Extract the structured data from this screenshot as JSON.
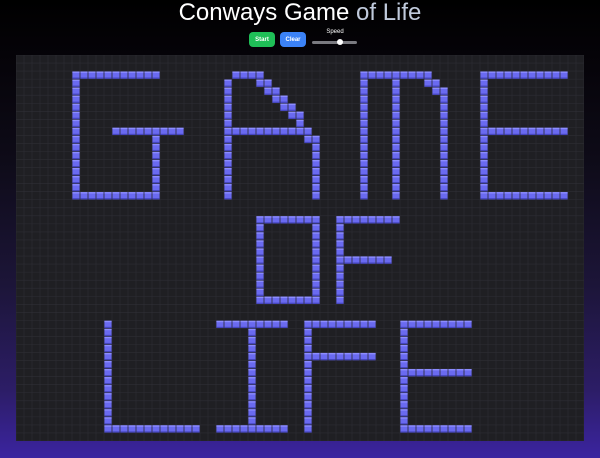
{
  "title": {
    "part1": "Conways ",
    "part2": "Game ",
    "part3": "of ",
    "part4": "Life"
  },
  "controls": {
    "start_label": "Start",
    "clear_label": "Clear",
    "speed_label": "Speed",
    "speed_value": 0.65
  },
  "colors": {
    "start_button": "#1fbf57",
    "clear_button": "#3b82f6",
    "board_background": "#1f1f23",
    "grid_line": "#2e2e35",
    "live_cell": "#6a6af0",
    "live_cell_highlight": "#8c8cff",
    "live_cell_shadow": "#4545c0"
  },
  "board": {
    "columns": 71,
    "rows": 48,
    "live_cells": [
      [
        7,
        2
      ],
      [
        8,
        2
      ],
      [
        9,
        2
      ],
      [
        10,
        2
      ],
      [
        11,
        2
      ],
      [
        12,
        2
      ],
      [
        13,
        2
      ],
      [
        14,
        2
      ],
      [
        15,
        2
      ],
      [
        16,
        2
      ],
      [
        17,
        2
      ],
      [
        7,
        3
      ],
      [
        7,
        4
      ],
      [
        7,
        5
      ],
      [
        7,
        6
      ],
      [
        7,
        7
      ],
      [
        7,
        8
      ],
      [
        7,
        9
      ],
      [
        7,
        10
      ],
      [
        7,
        11
      ],
      [
        7,
        12
      ],
      [
        7,
        13
      ],
      [
        7,
        14
      ],
      [
        7,
        15
      ],
      [
        7,
        16
      ],
      [
        7,
        17
      ],
      [
        8,
        17
      ],
      [
        9,
        17
      ],
      [
        10,
        17
      ],
      [
        11,
        17
      ],
      [
        12,
        17
      ],
      [
        13,
        17
      ],
      [
        14,
        17
      ],
      [
        15,
        17
      ],
      [
        16,
        17
      ],
      [
        17,
        17
      ],
      [
        12,
        9
      ],
      [
        13,
        9
      ],
      [
        14,
        9
      ],
      [
        15,
        9
      ],
      [
        16,
        9
      ],
      [
        17,
        9
      ],
      [
        18,
        9
      ],
      [
        19,
        9
      ],
      [
        20,
        9
      ],
      [
        17,
        10
      ],
      [
        17,
        11
      ],
      [
        17,
        12
      ],
      [
        17,
        13
      ],
      [
        17,
        14
      ],
      [
        17,
        15
      ],
      [
        17,
        16
      ],
      [
        27,
        2
      ],
      [
        28,
        2
      ],
      [
        29,
        2
      ],
      [
        30,
        2
      ],
      [
        26,
        3
      ],
      [
        30,
        3
      ],
      [
        31,
        3
      ],
      [
        26,
        4
      ],
      [
        31,
        4
      ],
      [
        32,
        4
      ],
      [
        26,
        5
      ],
      [
        32,
        5
      ],
      [
        33,
        5
      ],
      [
        26,
        6
      ],
      [
        33,
        6
      ],
      [
        34,
        6
      ],
      [
        26,
        7
      ],
      [
        34,
        7
      ],
      [
        35,
        7
      ],
      [
        26,
        8
      ],
      [
        35,
        8
      ],
      [
        26,
        9
      ],
      [
        27,
        9
      ],
      [
        28,
        9
      ],
      [
        29,
        9
      ],
      [
        30,
        9
      ],
      [
        31,
        9
      ],
      [
        32,
        9
      ],
      [
        33,
        9
      ],
      [
        34,
        9
      ],
      [
        35,
        9
      ],
      [
        36,
        9
      ],
      [
        26,
        10
      ],
      [
        36,
        10
      ],
      [
        37,
        10
      ],
      [
        26,
        11
      ],
      [
        37,
        11
      ],
      [
        26,
        12
      ],
      [
        37,
        12
      ],
      [
        26,
        13
      ],
      [
        37,
        13
      ],
      [
        26,
        14
      ],
      [
        37,
        14
      ],
      [
        26,
        15
      ],
      [
        37,
        15
      ],
      [
        26,
        16
      ],
      [
        37,
        16
      ],
      [
        26,
        17
      ],
      [
        37,
        17
      ],
      [
        43,
        2
      ],
      [
        44,
        2
      ],
      [
        45,
        2
      ],
      [
        46,
        2
      ],
      [
        47,
        2
      ],
      [
        48,
        2
      ],
      [
        49,
        2
      ],
      [
        50,
        2
      ],
      [
        51,
        2
      ],
      [
        43,
        3
      ],
      [
        47,
        3
      ],
      [
        51,
        3
      ],
      [
        52,
        3
      ],
      [
        43,
        4
      ],
      [
        47,
        4
      ],
      [
        52,
        4
      ],
      [
        53,
        4
      ],
      [
        43,
        5
      ],
      [
        47,
        5
      ],
      [
        53,
        5
      ],
      [
        43,
        6
      ],
      [
        47,
        6
      ],
      [
        53,
        6
      ],
      [
        43,
        7
      ],
      [
        47,
        7
      ],
      [
        53,
        7
      ],
      [
        43,
        8
      ],
      [
        47,
        8
      ],
      [
        53,
        8
      ],
      [
        43,
        9
      ],
      [
        47,
        9
      ],
      [
        53,
        9
      ],
      [
        43,
        10
      ],
      [
        47,
        10
      ],
      [
        53,
        10
      ],
      [
        43,
        11
      ],
      [
        47,
        11
      ],
      [
        53,
        11
      ],
      [
        43,
        12
      ],
      [
        47,
        12
      ],
      [
        53,
        12
      ],
      [
        43,
        13
      ],
      [
        47,
        13
      ],
      [
        53,
        13
      ],
      [
        43,
        14
      ],
      [
        47,
        14
      ],
      [
        53,
        14
      ],
      [
        43,
        15
      ],
      [
        47,
        15
      ],
      [
        53,
        15
      ],
      [
        43,
        16
      ],
      [
        47,
        16
      ],
      [
        53,
        16
      ],
      [
        43,
        17
      ],
      [
        47,
        17
      ],
      [
        53,
        17
      ],
      [
        58,
        2
      ],
      [
        59,
        2
      ],
      [
        60,
        2
      ],
      [
        61,
        2
      ],
      [
        62,
        2
      ],
      [
        63,
        2
      ],
      [
        64,
        2
      ],
      [
        65,
        2
      ],
      [
        66,
        2
      ],
      [
        67,
        2
      ],
      [
        68,
        2
      ],
      [
        58,
        3
      ],
      [
        58,
        4
      ],
      [
        58,
        5
      ],
      [
        58,
        6
      ],
      [
        58,
        7
      ],
      [
        58,
        8
      ],
      [
        58,
        9
      ],
      [
        58,
        10
      ],
      [
        58,
        11
      ],
      [
        58,
        12
      ],
      [
        58,
        13
      ],
      [
        58,
        14
      ],
      [
        58,
        15
      ],
      [
        58,
        16
      ],
      [
        58,
        17
      ],
      [
        59,
        9
      ],
      [
        60,
        9
      ],
      [
        61,
        9
      ],
      [
        62,
        9
      ],
      [
        63,
        9
      ],
      [
        64,
        9
      ],
      [
        65,
        9
      ],
      [
        66,
        9
      ],
      [
        67,
        9
      ],
      [
        68,
        9
      ],
      [
        59,
        17
      ],
      [
        60,
        17
      ],
      [
        61,
        17
      ],
      [
        62,
        17
      ],
      [
        63,
        17
      ],
      [
        64,
        17
      ],
      [
        65,
        17
      ],
      [
        66,
        17
      ],
      [
        67,
        17
      ],
      [
        68,
        17
      ],
      [
        30,
        20
      ],
      [
        31,
        20
      ],
      [
        32,
        20
      ],
      [
        33,
        20
      ],
      [
        34,
        20
      ],
      [
        35,
        20
      ],
      [
        36,
        20
      ],
      [
        37,
        20
      ],
      [
        30,
        21
      ],
      [
        37,
        21
      ],
      [
        30,
        22
      ],
      [
        37,
        22
      ],
      [
        30,
        23
      ],
      [
        37,
        23
      ],
      [
        30,
        24
      ],
      [
        37,
        24
      ],
      [
        30,
        25
      ],
      [
        37,
        25
      ],
      [
        30,
        26
      ],
      [
        37,
        26
      ],
      [
        30,
        27
      ],
      [
        37,
        27
      ],
      [
        30,
        28
      ],
      [
        37,
        28
      ],
      [
        30,
        29
      ],
      [
        37,
        29
      ],
      [
        30,
        30
      ],
      [
        31,
        30
      ],
      [
        32,
        30
      ],
      [
        33,
        30
      ],
      [
        34,
        30
      ],
      [
        35,
        30
      ],
      [
        36,
        30
      ],
      [
        37,
        30
      ],
      [
        40,
        20
      ],
      [
        41,
        20
      ],
      [
        42,
        20
      ],
      [
        43,
        20
      ],
      [
        44,
        20
      ],
      [
        45,
        20
      ],
      [
        46,
        20
      ],
      [
        47,
        20
      ],
      [
        40,
        21
      ],
      [
        40,
        22
      ],
      [
        40,
        23
      ],
      [
        40,
        24
      ],
      [
        40,
        25
      ],
      [
        40,
        26
      ],
      [
        40,
        27
      ],
      [
        40,
        28
      ],
      [
        40,
        29
      ],
      [
        40,
        30
      ],
      [
        41,
        25
      ],
      [
        42,
        25
      ],
      [
        43,
        25
      ],
      [
        44,
        25
      ],
      [
        45,
        25
      ],
      [
        46,
        25
      ],
      [
        11,
        33
      ],
      [
        11,
        34
      ],
      [
        11,
        35
      ],
      [
        11,
        36
      ],
      [
        11,
        37
      ],
      [
        11,
        38
      ],
      [
        11,
        39
      ],
      [
        11,
        40
      ],
      [
        11,
        41
      ],
      [
        11,
        42
      ],
      [
        11,
        43
      ],
      [
        11,
        44
      ],
      [
        11,
        45
      ],
      [
        11,
        46
      ],
      [
        12,
        46
      ],
      [
        13,
        46
      ],
      [
        14,
        46
      ],
      [
        15,
        46
      ],
      [
        16,
        46
      ],
      [
        17,
        46
      ],
      [
        18,
        46
      ],
      [
        19,
        46
      ],
      [
        20,
        46
      ],
      [
        21,
        46
      ],
      [
        22,
        46
      ],
      [
        25,
        33
      ],
      [
        26,
        33
      ],
      [
        27,
        33
      ],
      [
        28,
        33
      ],
      [
        29,
        33
      ],
      [
        30,
        33
      ],
      [
        31,
        33
      ],
      [
        32,
        33
      ],
      [
        33,
        33
      ],
      [
        29,
        34
      ],
      [
        29,
        35
      ],
      [
        29,
        36
      ],
      [
        29,
        37
      ],
      [
        29,
        38
      ],
      [
        29,
        39
      ],
      [
        29,
        40
      ],
      [
        29,
        41
      ],
      [
        29,
        42
      ],
      [
        29,
        43
      ],
      [
        29,
        44
      ],
      [
        29,
        45
      ],
      [
        25,
        46
      ],
      [
        26,
        46
      ],
      [
        27,
        46
      ],
      [
        28,
        46
      ],
      [
        29,
        46
      ],
      [
        30,
        46
      ],
      [
        31,
        46
      ],
      [
        32,
        46
      ],
      [
        33,
        46
      ],
      [
        36,
        33
      ],
      [
        37,
        33
      ],
      [
        38,
        33
      ],
      [
        39,
        33
      ],
      [
        40,
        33
      ],
      [
        41,
        33
      ],
      [
        42,
        33
      ],
      [
        43,
        33
      ],
      [
        44,
        33
      ],
      [
        36,
        34
      ],
      [
        36,
        35
      ],
      [
        36,
        36
      ],
      [
        36,
        37
      ],
      [
        36,
        38
      ],
      [
        36,
        39
      ],
      [
        36,
        40
      ],
      [
        36,
        41
      ],
      [
        36,
        42
      ],
      [
        36,
        43
      ],
      [
        36,
        44
      ],
      [
        36,
        45
      ],
      [
        36,
        46
      ],
      [
        37,
        37
      ],
      [
        38,
        37
      ],
      [
        39,
        37
      ],
      [
        40,
        37
      ],
      [
        41,
        37
      ],
      [
        42,
        37
      ],
      [
        43,
        37
      ],
      [
        44,
        37
      ],
      [
        48,
        33
      ],
      [
        49,
        33
      ],
      [
        50,
        33
      ],
      [
        51,
        33
      ],
      [
        52,
        33
      ],
      [
        53,
        33
      ],
      [
        54,
        33
      ],
      [
        55,
        33
      ],
      [
        56,
        33
      ],
      [
        48,
        34
      ],
      [
        48,
        35
      ],
      [
        48,
        36
      ],
      [
        48,
        37
      ],
      [
        48,
        38
      ],
      [
        48,
        39
      ],
      [
        48,
        40
      ],
      [
        48,
        41
      ],
      [
        48,
        42
      ],
      [
        48,
        43
      ],
      [
        48,
        44
      ],
      [
        48,
        45
      ],
      [
        48,
        46
      ],
      [
        49,
        39
      ],
      [
        50,
        39
      ],
      [
        51,
        39
      ],
      [
        52,
        39
      ],
      [
        53,
        39
      ],
      [
        54,
        39
      ],
      [
        55,
        39
      ],
      [
        56,
        39
      ],
      [
        49,
        46
      ],
      [
        50,
        46
      ],
      [
        51,
        46
      ],
      [
        52,
        46
      ],
      [
        53,
        46
      ],
      [
        54,
        46
      ],
      [
        55,
        46
      ],
      [
        56,
        46
      ]
    ]
  }
}
